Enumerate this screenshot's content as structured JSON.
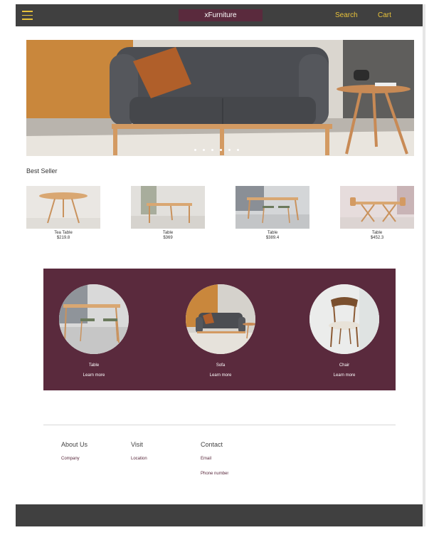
{
  "header": {
    "brand": "xFurniture",
    "search_label": "Search",
    "cart_label": "Cart",
    "menu_icon": "hamburger-menu-icon"
  },
  "hero": {
    "slide_count": 6
  },
  "best_seller": {
    "title": "Best Seller",
    "products": [
      {
        "name": "Tea Table",
        "price": "$219.8"
      },
      {
        "name": "Table",
        "price": "$369"
      },
      {
        "name": "Table",
        "price": "$389.4"
      },
      {
        "name": "Table",
        "price": "$452.3"
      }
    ]
  },
  "categories": {
    "items": [
      {
        "name": "Table",
        "link": "Learn more"
      },
      {
        "name": "Sofa",
        "link": "Learn more"
      },
      {
        "name": "Chair",
        "link": "Learn more"
      }
    ]
  },
  "footer": {
    "about": {
      "heading": "About Us",
      "link": "Company"
    },
    "visit": {
      "heading": "Visit",
      "link": "Location"
    },
    "contact": {
      "heading": "Contact",
      "link1": "Email",
      "link2": "Phone number"
    }
  },
  "colors": {
    "header_bg": "#404040",
    "accent_gold": "#e8c23a",
    "brand_plum": "#5a2a3d"
  }
}
